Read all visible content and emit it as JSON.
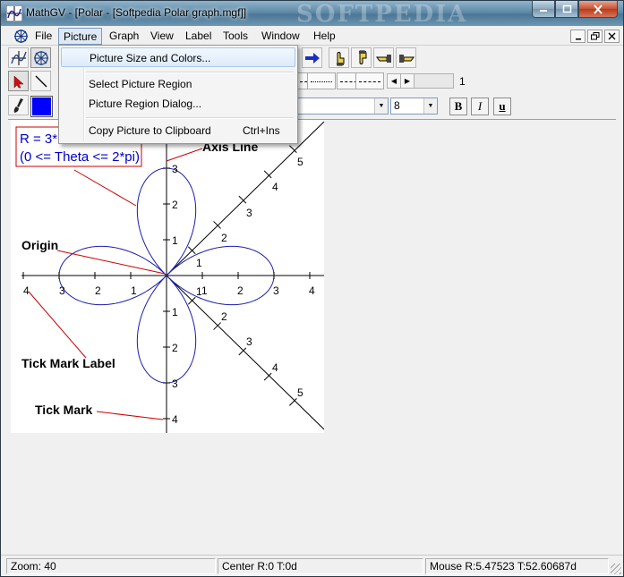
{
  "window": {
    "title": "MathGV - [Polar - [Softpedia Polar graph.mgf]]",
    "watermark": "SOFTPEDIA"
  },
  "menubar": {
    "items": [
      "File",
      "Picture",
      "Graph",
      "View",
      "Label",
      "Tools",
      "Window",
      "Help"
    ],
    "active": "Picture"
  },
  "picture_menu": {
    "items": [
      {
        "label": "Picture Size and Colors...",
        "shortcut": ""
      },
      {
        "label": "Select Picture Region",
        "shortcut": ""
      },
      {
        "label": "Picture Region Dialog...",
        "shortcut": ""
      },
      {
        "label": "Copy Picture to Clipboard",
        "shortcut": "Ctrl+Ins"
      }
    ],
    "highlighted": "Picture Size and Colors..."
  },
  "toolbar": {
    "line_width_value": "1",
    "font_size_value": "8",
    "bold_label": "B",
    "italic_label": "I",
    "underline_label": "u",
    "current_color": "#0000ff"
  },
  "graph": {
    "equation_line1": "R = 3*",
    "equation_line2": "(0 <= Theta <= 2*pi)",
    "labels": {
      "axis_line": "Axis Line",
      "origin": "Origin",
      "tick_mark_label": "Tick Mark Label",
      "tick_mark": "Tick Mark"
    },
    "x_ticks_left": [
      "4",
      "3",
      "2",
      "1"
    ],
    "x_ticks_right": [
      "1",
      "2",
      "3",
      "4"
    ],
    "y_ticks_up": [
      "1",
      "2",
      "3"
    ],
    "y_ticks_down": [
      "1",
      "2",
      "3",
      "4"
    ],
    "diag_up_ticks": [
      "1",
      "2",
      "3",
      "4",
      "5"
    ],
    "diag_down_ticks": [
      "1",
      "2",
      "3",
      "4",
      "5"
    ],
    "curve_color": "#1c1cb0",
    "annotation_color": "#cc0000",
    "equation_color": "#0000cc"
  },
  "statusbar": {
    "zoom": "Zoom: 40",
    "center": "Center R:0 T:0d",
    "mouse": "Mouse R:5.47523 T:52.60687d"
  }
}
